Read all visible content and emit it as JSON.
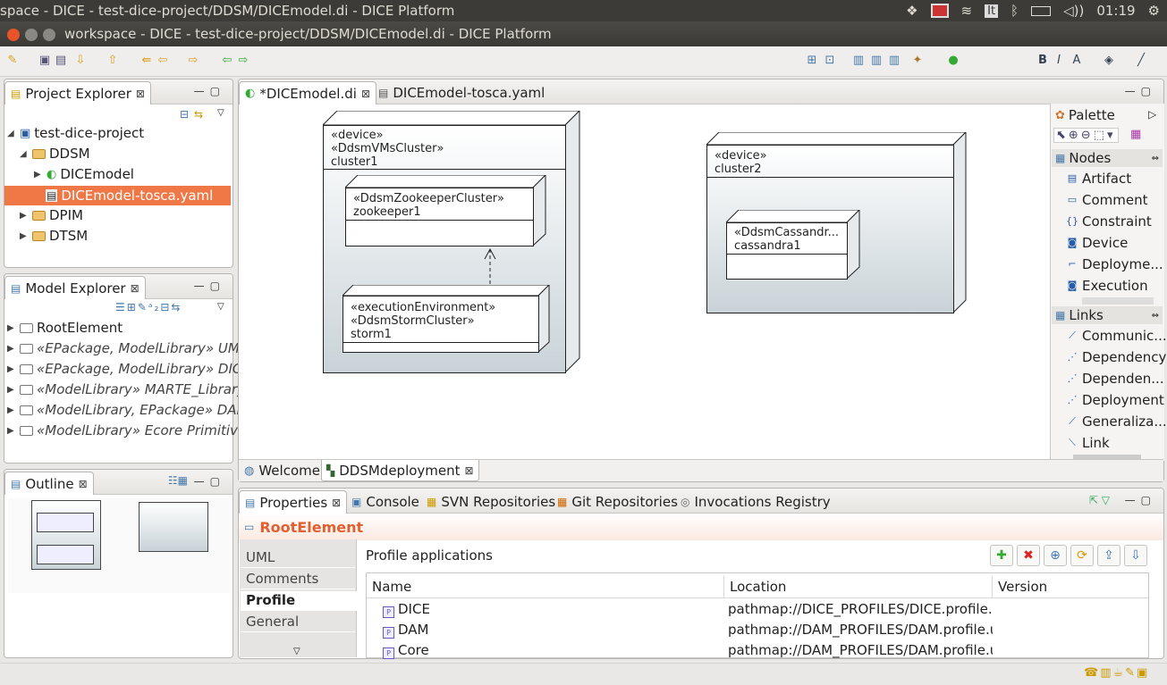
{
  "system_bar": {
    "title": "space - DICE - test-dice-project/DDSM/DICEmodel.di - DICE Platform",
    "time": "01:19",
    "keyboard": "It"
  },
  "window": {
    "title": "workspace - DICE - test-dice-project/DDSM/DICEmodel.di - DICE Platform"
  },
  "project_explorer": {
    "tab": "Project Explorer",
    "items": [
      {
        "label": "test-dice-project"
      },
      {
        "label": "DDSM"
      },
      {
        "label": "DICEmodel"
      },
      {
        "label": "DICEmodel-tosca.yaml"
      },
      {
        "label": "DPIM"
      },
      {
        "label": "DTSM"
      }
    ]
  },
  "model_explorer": {
    "tab": "Model Explorer",
    "items": [
      {
        "label": "RootElement"
      },
      {
        "label": "«EPackage, ModelLibrary» UML P"
      },
      {
        "label": "«EPackage, ModelLibrary» DICE_L"
      },
      {
        "label": "«ModelLibrary» MARTE_Library"
      },
      {
        "label": "«ModelLibrary, EPackage» DAM_I"
      },
      {
        "label": "«ModelLibrary» Ecore Primitive Ty"
      }
    ]
  },
  "outline": {
    "tab": "Outline"
  },
  "editor": {
    "tabs": [
      {
        "label": "*DICEmodel.di"
      },
      {
        "label": "DICEmodel-tosca.yaml"
      }
    ],
    "bottom_tabs": [
      {
        "label": "Welcome"
      },
      {
        "label": "DDSMdeployment"
      }
    ],
    "nodes": {
      "cluster1": {
        "lines": [
          "«device»",
          "«DdsmVMsCluster»",
          "cluster1"
        ]
      },
      "zookeeper1": {
        "lines": [
          "«DdsmZookeeperCluster»",
          "zookeeper1"
        ]
      },
      "storm1": {
        "lines": [
          "«executionEnvironment»",
          "«DdsmStormCluster»",
          "storm1"
        ]
      },
      "cluster2": {
        "lines": [
          "«device»",
          "cluster2"
        ]
      },
      "cassandra1": {
        "lines": [
          "«DdsmCassandr...",
          "cassandra1"
        ]
      }
    }
  },
  "palette": {
    "title": "Palette",
    "nodes_header": "Nodes",
    "nodes": [
      "Artifact",
      "Comment",
      "Constraint",
      "Device",
      "Deployme...",
      "Execution"
    ],
    "links_header": "Links",
    "links": [
      "Communic...",
      "Dependency",
      "Dependen...",
      "Deployment",
      "Generaliza...",
      "Link"
    ]
  },
  "properties": {
    "tabs": [
      "Properties",
      "Console",
      "SVN Repositories",
      "Git Repositories",
      "Invocations Registry"
    ],
    "element": "RootElement",
    "side_tabs": [
      "UML",
      "Comments",
      "Profile",
      "General"
    ],
    "active_side_tab": "Profile",
    "section_title": "Profile applications",
    "columns": [
      "Name",
      "Location",
      "Version"
    ],
    "rows": [
      {
        "name": "DICE",
        "location": "pathmap://DICE_PROFILES/DICE.profile.um"
      },
      {
        "name": "DAM",
        "location": "pathmap://DAM_PROFILES/DAM.profile.um"
      },
      {
        "name": "Core",
        "location": "pathmap://DAM_PROFILES/DAM.profile.um"
      }
    ]
  },
  "colors": {
    "selection": "#f07746",
    "element_title": "#e2602f",
    "os_bar": "#3c3b37"
  }
}
